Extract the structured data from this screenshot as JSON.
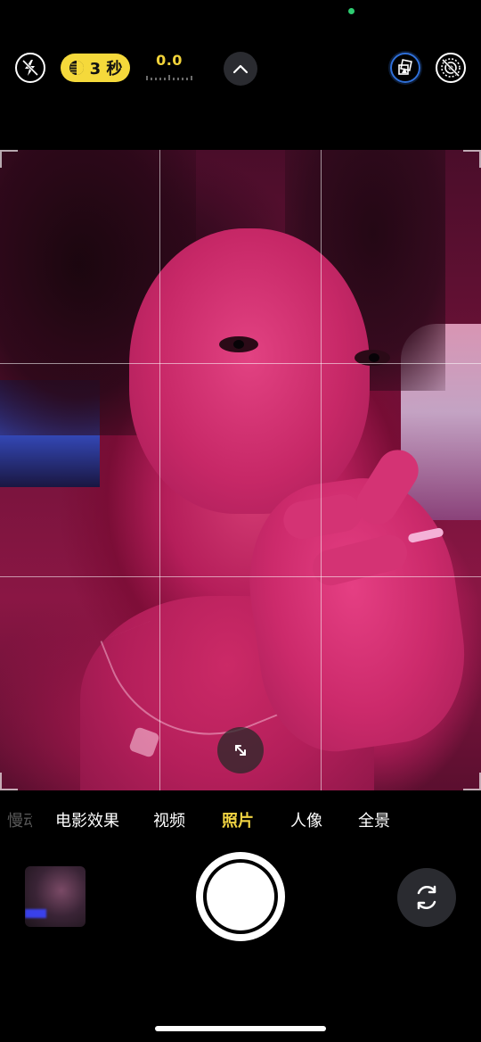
{
  "status": {
    "indicator_color": "#2ecc71"
  },
  "top_bar": {
    "flash": {
      "icon": "flash-off-icon"
    },
    "timer": {
      "icon": "night-mode-icon",
      "label": "3 秒"
    },
    "exposure": {
      "value": "0.0"
    },
    "controls_toggle": {
      "icon": "chevron-up-icon"
    },
    "styles": {
      "icon": "photographic-styles-icon"
    },
    "live": {
      "icon": "live-photo-off-icon"
    }
  },
  "viewfinder": {
    "grid": true,
    "zoom_toggle_icon": "expand-arrows-icon"
  },
  "modes": {
    "items": [
      "慢动作",
      "电影效果",
      "视频",
      "照片",
      "人像",
      "全景"
    ],
    "selected": "照片"
  },
  "bottom_bar": {
    "thumbnail": {
      "icon": "last-photo-thumbnail"
    },
    "shutter": {
      "icon": "shutter-button"
    },
    "flip": {
      "icon": "camera-flip-icon"
    }
  }
}
